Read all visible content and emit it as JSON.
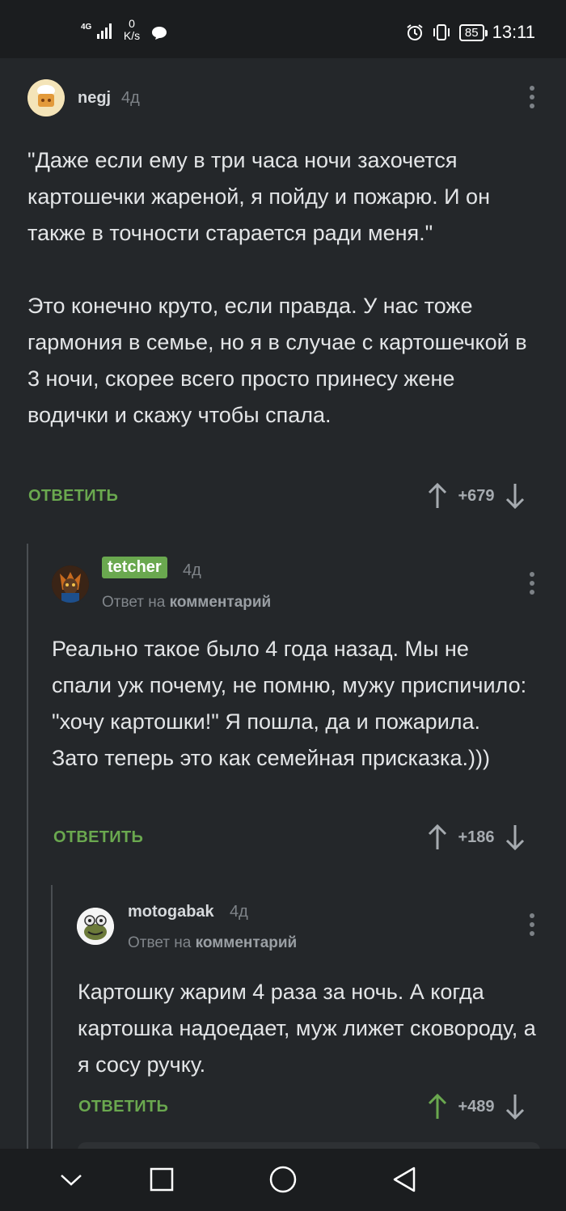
{
  "status_bar": {
    "network": "4G",
    "speed_value": "0",
    "speed_unit": "K/s",
    "battery": "85",
    "time": "13:11"
  },
  "comments": [
    {
      "username": "negj",
      "time": "4д",
      "body": "\"Даже если ему в три часа ночи захочется картошечки жареной, я пойду и пожарю. И он также в точности старается ради меня.\"\n\nЭто конечно круто, если правда. У нас тоже гармония в семье, но я в случае с картошечкой в 3 ночи, скорее всего просто принесу жене водички и скажу чтобы спала.",
      "reply_label": "ОТВЕТИТЬ",
      "rating": "+679"
    },
    {
      "username": "tetcher",
      "time": "4д",
      "reply_to_prefix": "Ответ на",
      "reply_to_link": "комментарий",
      "body": "Реально такое было 4 года назад. Мы не спали уж почему, не помню, мужу приспичило: \"хочу картошки!\" Я пошла, да и пожарила. Зато теперь это как семейная присказка.)))",
      "reply_label": "ОТВЕТИТЬ",
      "rating": "+186"
    },
    {
      "username": "motogabak",
      "time": "4д",
      "reply_to_prefix": "Ответ на",
      "reply_to_link": "комментарий",
      "body": "Картошку жарим 4 раза за ночь. А когда картошка надоедает, муж лижет сковороду, а я сосу ручку.",
      "reply_label": "ОТВЕТИТЬ",
      "rating": "+489",
      "upvoted": true
    }
  ],
  "colors": {
    "background": "#24272a",
    "accent_green": "#6aa84f",
    "text": "#e3e5e7",
    "muted": "#7e8388"
  }
}
